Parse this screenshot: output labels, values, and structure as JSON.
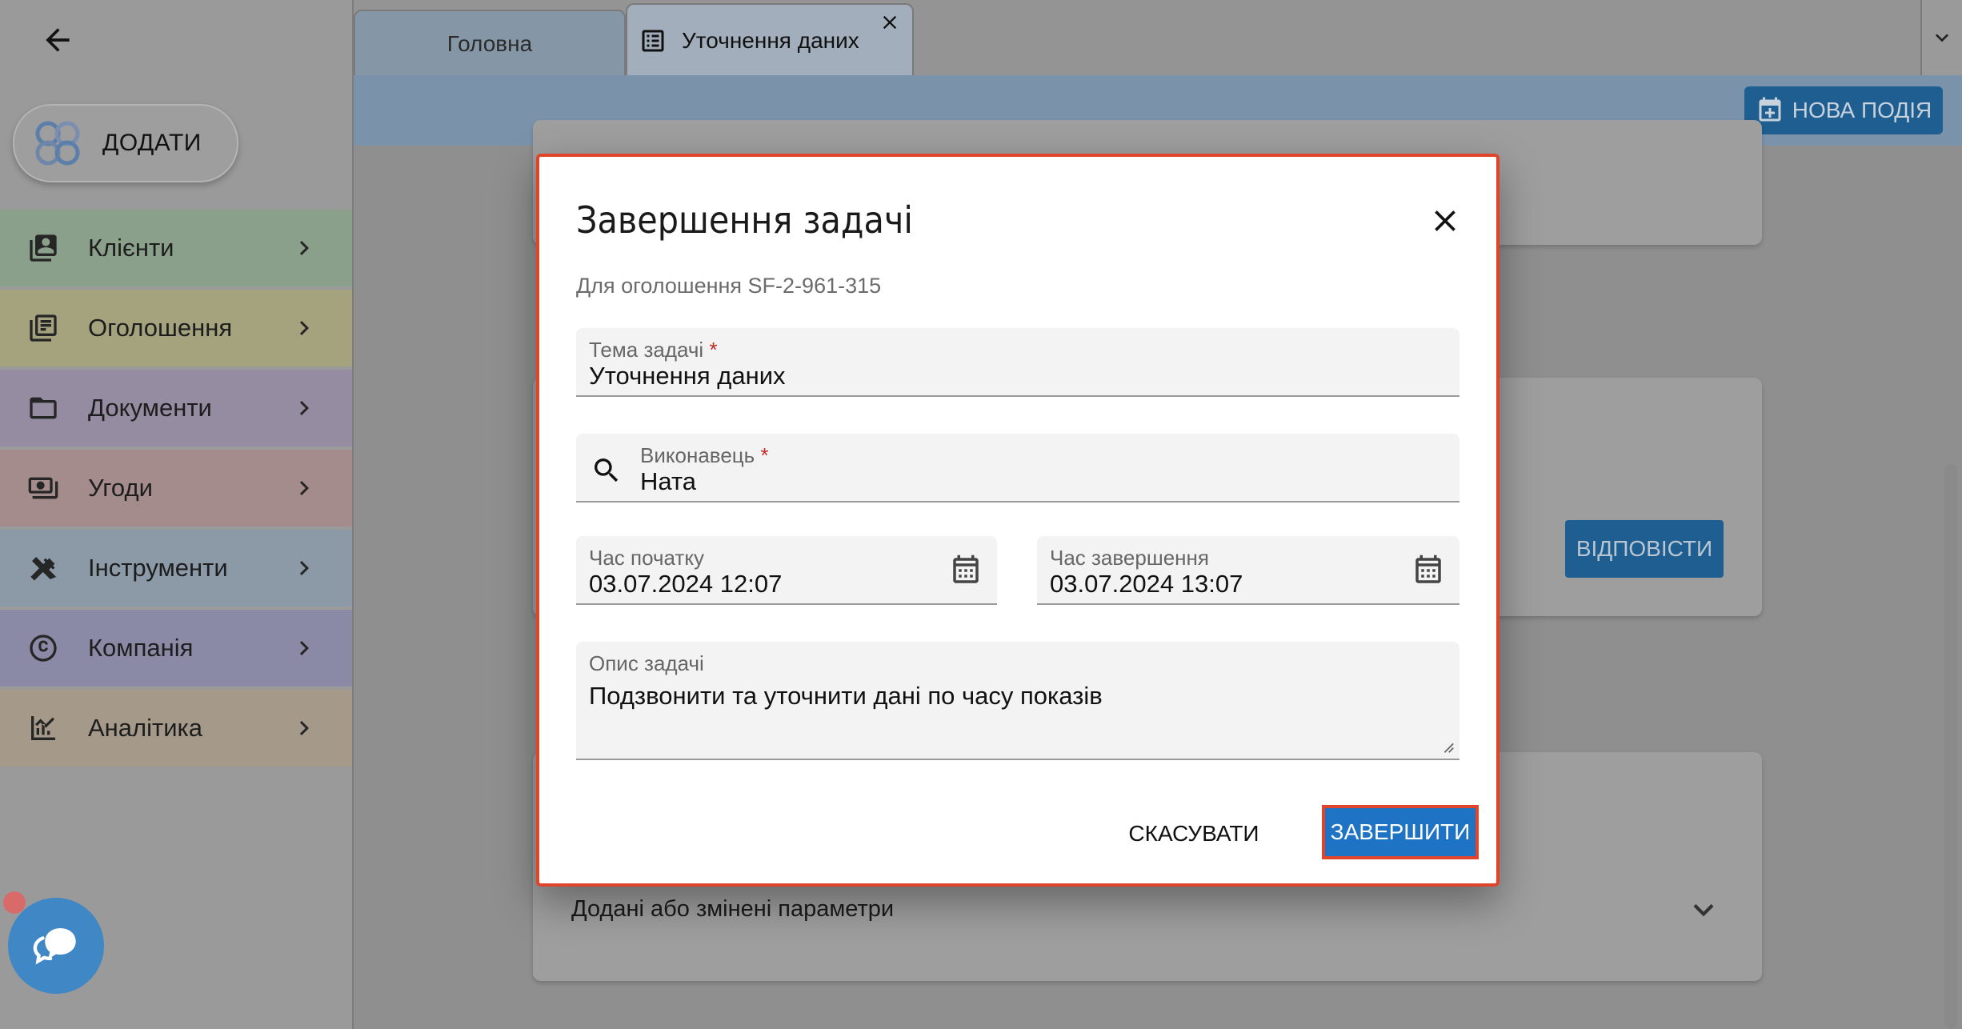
{
  "colors": {
    "accent": "#1f73c5",
    "highlight": "#e0452c",
    "dark_button": "#1f5e91"
  },
  "sidebar": {
    "add_label": "ДОДАТИ",
    "items": [
      {
        "label": "Клієнти",
        "icon": "contacts-icon",
        "color": "#8aa08a"
      },
      {
        "label": "Оголошення",
        "icon": "listing-icon",
        "color": "#a5a27e"
      },
      {
        "label": "Документи",
        "icon": "folder-icon",
        "color": "#968ca2"
      },
      {
        "label": "Угоди",
        "icon": "money-icon",
        "color": "#a58c8c"
      },
      {
        "label": "Інструменти",
        "icon": "tools-icon",
        "color": "#8c9aa8"
      },
      {
        "label": "Компанія",
        "icon": "copyright-icon",
        "color": "#8a8aa6"
      },
      {
        "label": "Аналітика",
        "icon": "analytics-icon",
        "color": "#a59a8a"
      }
    ]
  },
  "tabs": {
    "home_label": "Головна",
    "active_label": "Уточнення даних"
  },
  "toolbar": {
    "new_event_label": "НОВА ПОДІЯ"
  },
  "background": {
    "reply_label": "ВІДПОВІСТИ",
    "params_label": "Додані або змінені параметри"
  },
  "dialog": {
    "title": "Завершення задачі",
    "subtitle": "Для оголошення SF-2-961-315",
    "topic": {
      "label": "Тема задачі",
      "value": "Уточнення даних"
    },
    "executor": {
      "label": "Виконавець",
      "value": "Ната"
    },
    "start": {
      "label": "Час початку",
      "value": "03.07.2024 12:07"
    },
    "end": {
      "label": "Час завершення",
      "value": "03.07.2024 13:07"
    },
    "description": {
      "label": "Опис задачі",
      "value": "Подзвонити та уточнити дані по часу показів"
    },
    "required_mark": "*",
    "cancel_label": "СКАСУВАТИ",
    "finish_label": "ЗАВЕРШИТИ"
  }
}
